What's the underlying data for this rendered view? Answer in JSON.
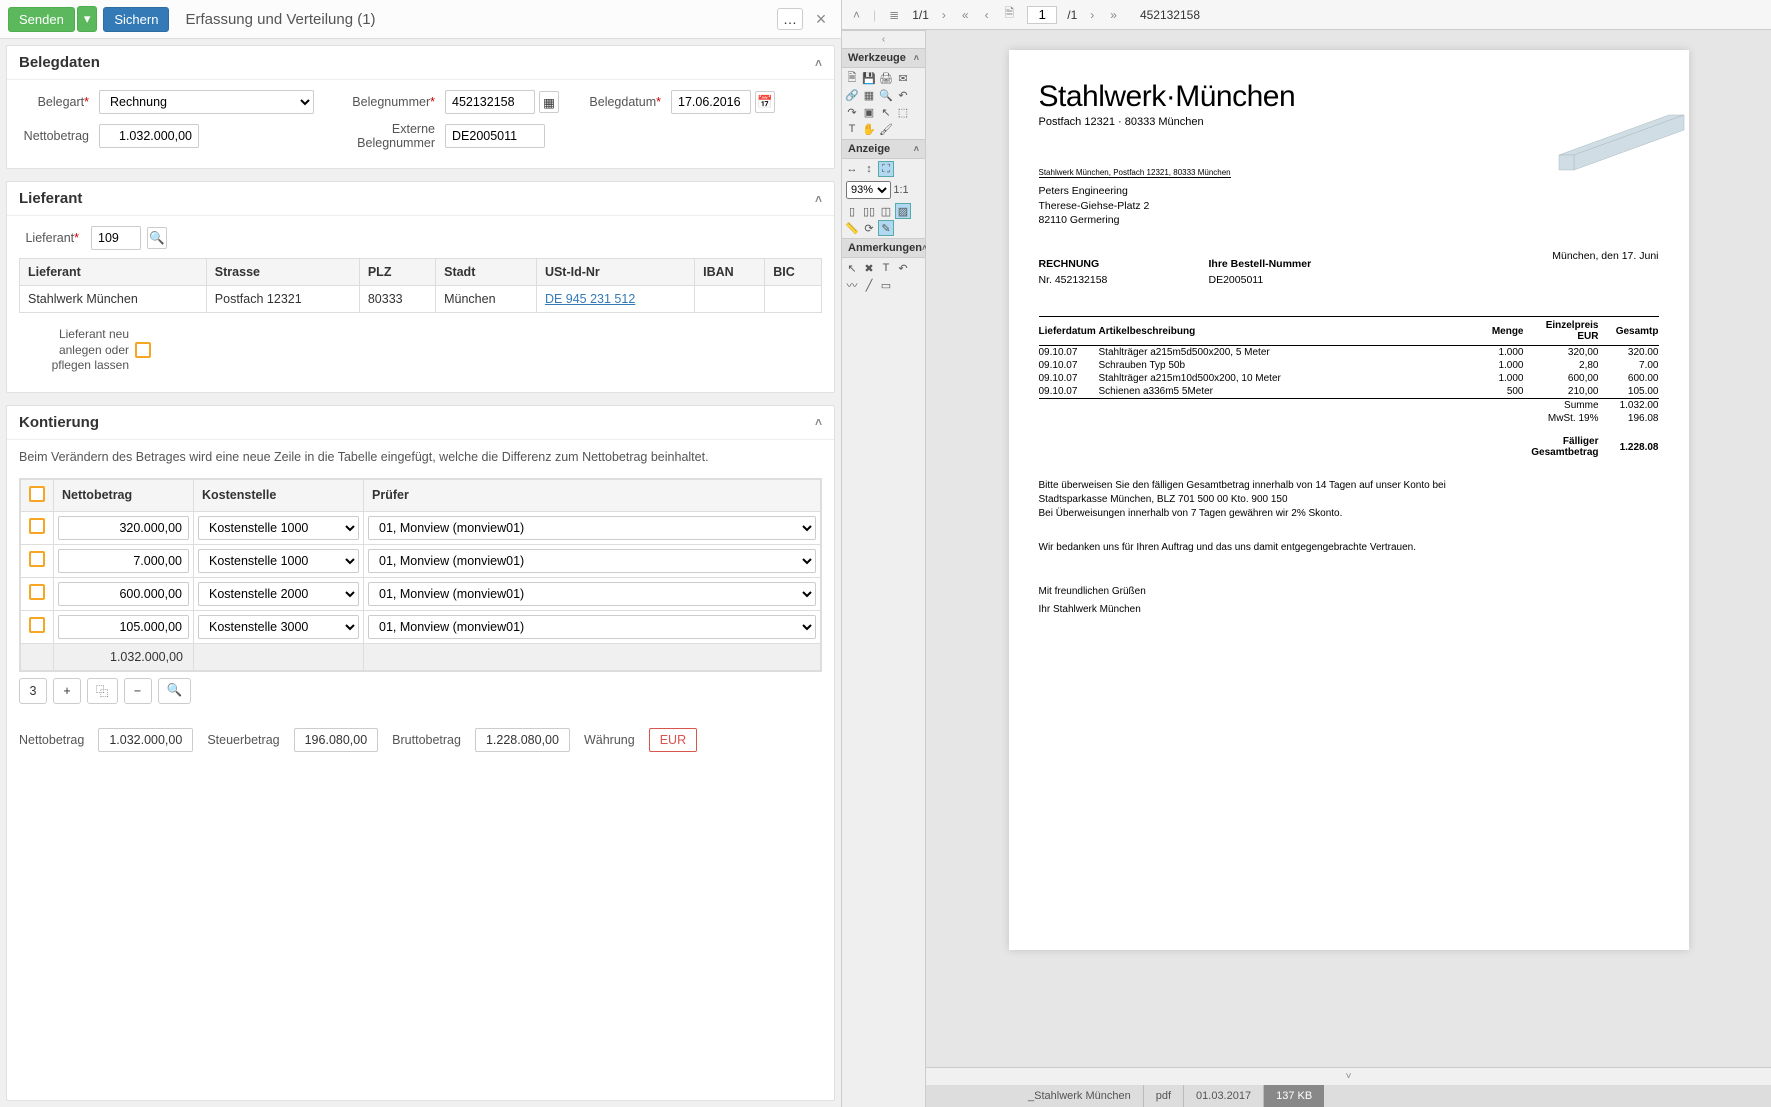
{
  "header": {
    "send": "Senden",
    "save": "Sichern",
    "title": "Erfassung und Verteilung (1)",
    "more": "…",
    "close": "×"
  },
  "belegdaten": {
    "title": "Belegdaten",
    "belegart_label": "Belegart",
    "belegart_value": "Rechnung",
    "belegnummer_label": "Belegnummer",
    "belegnummer_value": "452132158",
    "belegdatum_label": "Belegdatum",
    "belegdatum_value": "17.06.2016",
    "nettobetrag_label": "Nettobetrag",
    "nettobetrag_value": "1.032.000,00",
    "externe_label": "Externe Belegnummer",
    "externe_value": "DE2005011"
  },
  "lieferant": {
    "title": "Lieferant",
    "label": "Lieferant",
    "value": "109",
    "cols": {
      "c1": "Lieferant",
      "c2": "Strasse",
      "c3": "PLZ",
      "c4": "Stadt",
      "c5": "USt-Id-Nr",
      "c6": "IBAN",
      "c7": "BIC"
    },
    "row": {
      "c1": "Stahlwerk München",
      "c2": "Postfach 12321",
      "c3": "80333",
      "c4": "München",
      "c5": "DE 945 231 512",
      "c6": "",
      "c7": ""
    },
    "new_label": "Lieferant neu anlegen oder pflegen lassen"
  },
  "kontierung": {
    "title": "Kontierung",
    "hint": "Beim Verändern des Betrages wird eine neue Zeile in die Tabelle eingefügt, welche die Differenz zum Nettobetrag beinhaltet.",
    "cols": {
      "c1": "Nettobetrag",
      "c2": "Kostenstelle",
      "c3": "Prüfer"
    },
    "rows": [
      {
        "amount": "320.000,00",
        "ks": "Kostenstelle 1000",
        "pruefer": "01, Monview (monview01)"
      },
      {
        "amount": "7.000,00",
        "ks": "Kostenstelle 1000",
        "pruefer": "01, Monview (monview01)"
      },
      {
        "amount": "600.000,00",
        "ks": "Kostenstelle 2000",
        "pruefer": "01, Monview (monview01)"
      },
      {
        "amount": "105.000,00",
        "ks": "Kostenstelle 3000",
        "pruefer": "01, Monview (monview01)"
      }
    ],
    "sum": "1.032.000,00",
    "toolbar": {
      "count": "3",
      "plus": "+",
      "copy": "⿻",
      "minus": "−",
      "search": "🔍"
    }
  },
  "totals": {
    "netto_label": "Nettobetrag",
    "netto": "1.032.000,00",
    "steuer_label": "Steuerbetrag",
    "steuer": "196.080,00",
    "brutto_label": "Bruttobetrag",
    "brutto": "1.228.080,00",
    "waehrung_label": "Währung",
    "waehrung": "EUR"
  },
  "viewer": {
    "page_current": "1",
    "page_sep": "/1",
    "stack": "1/1",
    "docnum": "452132158",
    "panels": {
      "werkzeuge": "Werkzeuge",
      "anzeige": "Anzeige",
      "anmerkungen": "Anmerkungen"
    },
    "zoom": "93%"
  },
  "document": {
    "company": "Stahlwerk·München",
    "company_sub": "Postfach 12321 · 80333 München",
    "sender_line": "Stahlwerk München, Postfach 12321, 80333 München",
    "addr1": "Peters Engineering",
    "addr2": "Therese-Giehse-Platz 2",
    "addr3": "82110 Germering",
    "date": "München, den 17. Juni",
    "h_rechnung": "RECHNUNG",
    "h_bestell": "Ihre Bestell-Nummer",
    "nr_label": "Nr. 452132158",
    "bestell_val": "DE2005011",
    "th": {
      "lieferdatum": "Lieferdatum",
      "artikel": "Artikelbeschreibung",
      "menge": "Menge",
      "einzel": "Einzelpreis EUR",
      "gesamt": "Gesamtp"
    },
    "items": [
      {
        "d": "09.10.07",
        "a": "Stahlträger a215m5d500x200, 5 Meter",
        "m": "1.000",
        "e": "320,00",
        "g": "320.00"
      },
      {
        "d": "09.10.07",
        "a": "Schrauben Typ 50b",
        "m": "1.000",
        "e": "2,80",
        "g": "7.00"
      },
      {
        "d": "09.10.07",
        "a": "Stahlträger a215m10d500x200, 10 Meter",
        "m": "1.000",
        "e": "600,00",
        "g": "600.00"
      },
      {
        "d": "09.10.07",
        "a": "Schienen a336m5 5Meter",
        "m": "500",
        "e": "210,00",
        "g": "105.00"
      }
    ],
    "summe_l": "Summe",
    "summe_v": "1.032.00",
    "mwst_l": "MwSt. 19%",
    "mwst_v": "196.08",
    "faellig_l": "Fälliger Gesamtbetrag",
    "faellig_v": "1.228.08",
    "txt1": "Bitte überweisen Sie den fälligen Gesamtbetrag innerhalb von 14 Tagen auf unser Konto bei",
    "txt2": "Stadtsparkasse München, BLZ 701 500 00 Kto. 900 150",
    "txt3": "Bei Überweisungen innerhalb von 7 Tagen gewähren wir 2% Skonto.",
    "txt4": "Wir bedanken uns für Ihren Auftrag und das uns damit entgegengebrachte Vertrauen.",
    "gruss": "Mit freundlichen Grüßen",
    "sign": "Ihr Stahlwerk München"
  },
  "status": {
    "name": "_Stahlwerk München",
    "type": "pdf",
    "date": "01.03.2017",
    "size": "137 KB"
  }
}
